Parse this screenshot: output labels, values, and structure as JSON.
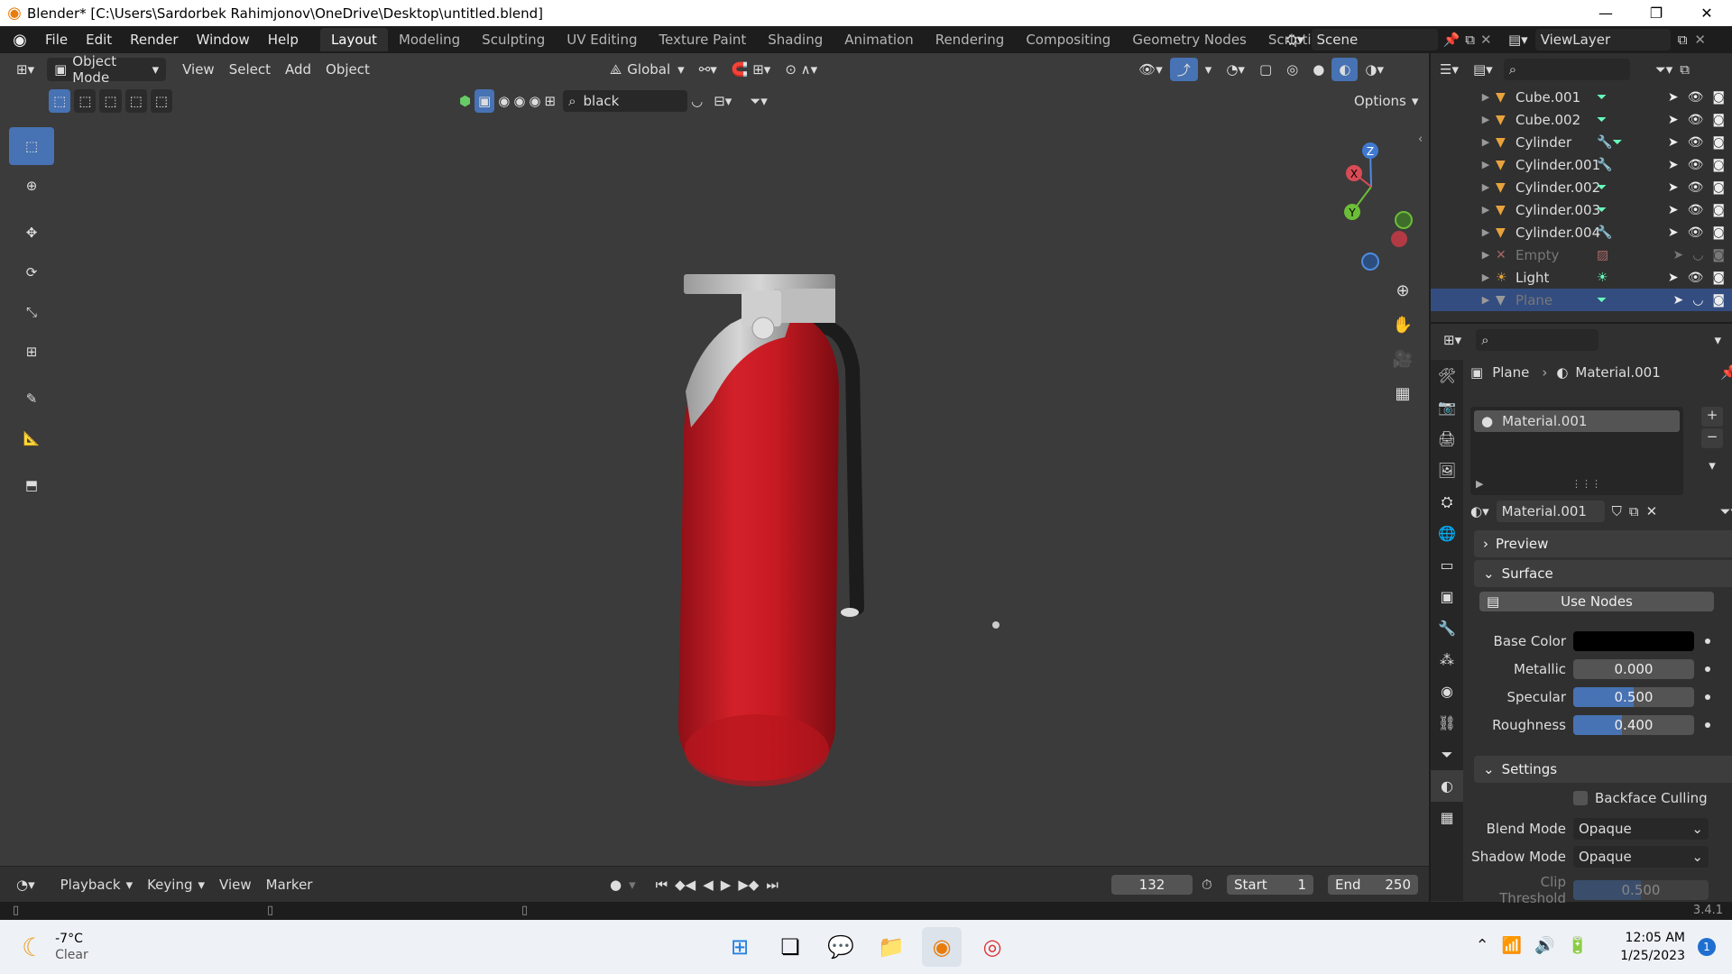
{
  "window": {
    "title": "Blender* [C:\\Users\\Sardorbek Rahimjonov\\OneDrive\\Desktop\\untitled.blend]"
  },
  "menu": [
    "File",
    "Edit",
    "Render",
    "Window",
    "Help"
  ],
  "workspaces": [
    "Layout",
    "Modeling",
    "Sculpting",
    "UV Editing",
    "Texture Paint",
    "Shading",
    "Animation",
    "Rendering",
    "Compositing",
    "Geometry Nodes",
    "Scripting"
  ],
  "scene": "Scene",
  "view_layer": "ViewLayer",
  "viewport": {
    "mode": "Object Mode",
    "menus": [
      "View",
      "Select",
      "Add",
      "Object"
    ],
    "orientation": "Global",
    "search_value": "black",
    "options_label": "Options",
    "gizmo": {
      "z": "Z",
      "y": "Y",
      "x": "X"
    }
  },
  "timeline": {
    "menus": [
      "Playback",
      "Keying",
      "View",
      "Marker"
    ],
    "current_frame": "132",
    "start_label": "Start",
    "start": "1",
    "end_label": "End",
    "end": "250"
  },
  "version": "3.4.1",
  "outliner": {
    "items": [
      {
        "name": "Cube.001",
        "type": "mesh"
      },
      {
        "name": "Cube.002",
        "type": "mesh"
      },
      {
        "name": "Cylinder",
        "type": "mesh"
      },
      {
        "name": "Cylinder.001",
        "type": "mesh"
      },
      {
        "name": "Cylinder.002",
        "type": "mesh"
      },
      {
        "name": "Cylinder.003",
        "type": "mesh"
      },
      {
        "name": "Cylinder.004",
        "type": "mesh"
      },
      {
        "name": "Empty",
        "type": "empty"
      },
      {
        "name": "Light",
        "type": "light"
      },
      {
        "name": "Plane",
        "type": "mesh"
      }
    ]
  },
  "properties": {
    "breadcrumb_object": "Plane",
    "breadcrumb_material": "Material.001",
    "slot": "Material.001",
    "material_name": "Material.001",
    "preview_label": "Preview",
    "surface_label": "Surface",
    "use_nodes_label": "Use Nodes",
    "base_color_label": "Base Color",
    "base_color": "#000000",
    "metallic_label": "Metallic",
    "metallic": "0.000",
    "specular_label": "Specular",
    "specular": "0.500",
    "roughness_label": "Roughness",
    "roughness": "0.400",
    "settings_label": "Settings",
    "backface_label": "Backface Culling",
    "blend_mode_label": "Blend Mode",
    "blend_mode": "Opaque",
    "shadow_mode_label": "Shadow Mode",
    "shadow_mode": "Opaque",
    "clip_label": "Clip Threshold",
    "clip": "0.500"
  },
  "taskbar": {
    "temp": "-7°C",
    "weather": "Clear",
    "time": "12:05 AM",
    "date": "1/25/2023",
    "notification_count": "1"
  },
  "colors": {
    "accent": "#4772b3",
    "extinguisher": "#c81a22"
  }
}
